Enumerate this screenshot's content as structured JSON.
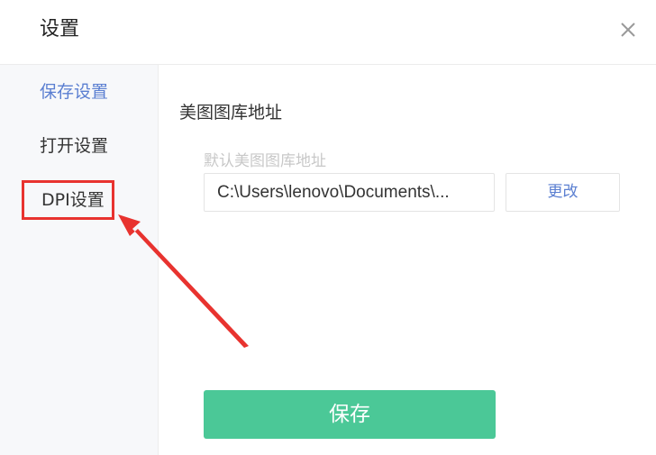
{
  "window": {
    "title": "设置",
    "close_icon": "close-icon"
  },
  "sidebar": {
    "items": [
      {
        "label": "保存设置",
        "state": "active"
      },
      {
        "label": "打开设置",
        "state": "normal"
      },
      {
        "label": "DPI设置",
        "state": "highlighted"
      }
    ]
  },
  "main": {
    "section_title": "美图图库地址",
    "field_label": "默认美图图库地址",
    "path_value": "C:\\Users\\lenovo\\Documents\\...",
    "change_label": "更改",
    "save_label": "保存"
  },
  "annotation": {
    "highlight_color": "#e8332f",
    "arrow_icon": "red-arrow-icon"
  },
  "colors": {
    "accent": "#5b7fd1",
    "save_button": "#4bc897"
  }
}
